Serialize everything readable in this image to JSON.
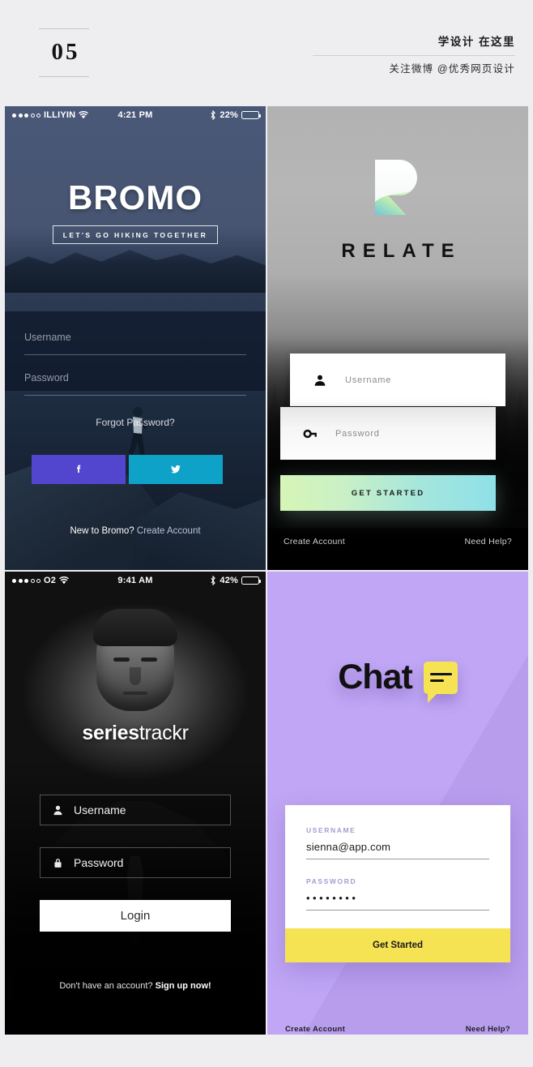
{
  "header": {
    "number": "05",
    "cn_top": "学设计 在这里",
    "cn_bottom": "关注微博 @优秀网页设计"
  },
  "panels": {
    "bromo": {
      "statusbar": {
        "carrier": "ILLIYIN",
        "time": "4:21 PM",
        "battery": "22%",
        "signal_dots_on": 3,
        "signal_dots_off": 2,
        "wifi_icon": "wifi-icon",
        "bluetooth_icon": "bluetooth-icon",
        "battery_icon": "battery-icon"
      },
      "title": "BROMO",
      "tagline": "LET'S GO HIKING TOGETHER",
      "username_placeholder": "Username",
      "password_placeholder": "Password",
      "forgot_password": "Forgot Password?",
      "facebook_icon": "facebook-icon",
      "twitter_icon": "twitter-icon",
      "bottom_prompt": "New to Bromo? ",
      "bottom_link": "Create Account",
      "colors": {
        "facebook": "#5246cf",
        "twitter": "#0fa2c9",
        "background": "#2b3a55"
      }
    },
    "relate": {
      "logo_icon": "relate-r-logo-icon",
      "name": "RELATE",
      "username_placeholder": "Username",
      "password_placeholder": "Password",
      "user_icon": "person-icon",
      "key_icon": "key-icon",
      "cta_label": "GET STARTED",
      "link_left": "Create Account",
      "link_right": "Need Help?",
      "colors": {
        "cta_gradient_from": "#d6f5b6",
        "cta_gradient_to": "#8fe0e8"
      }
    },
    "series": {
      "statusbar": {
        "carrier": "O2",
        "time": "9:41 AM",
        "battery": "42%",
        "signal_dots_on": 3,
        "signal_dots_off": 2,
        "wifi_icon": "wifi-icon",
        "bluetooth_icon": "bluetooth-icon",
        "battery_icon": "battery-icon"
      },
      "logo_bold": "series",
      "logo_light": "trackr",
      "username_placeholder": "Username",
      "password_placeholder": "Password",
      "user_icon": "person-icon",
      "lock_icon": "lock-icon",
      "login_label": "Login",
      "bottom_prompt": "Don't have an account? ",
      "bottom_link": "Sign up now!"
    },
    "chat": {
      "title": "Chat",
      "bubble_icon": "chat-bubble-icon",
      "username_label": "USERNAME",
      "username_value": "sienna@app.com",
      "password_label": "PASSWORD",
      "password_value": "••••••••",
      "cta_label": "Get Started",
      "link_left": "Create Account",
      "link_right": "Need Help?",
      "colors": {
        "background": "#c0a6f5",
        "accent": "#f6e354"
      }
    }
  }
}
